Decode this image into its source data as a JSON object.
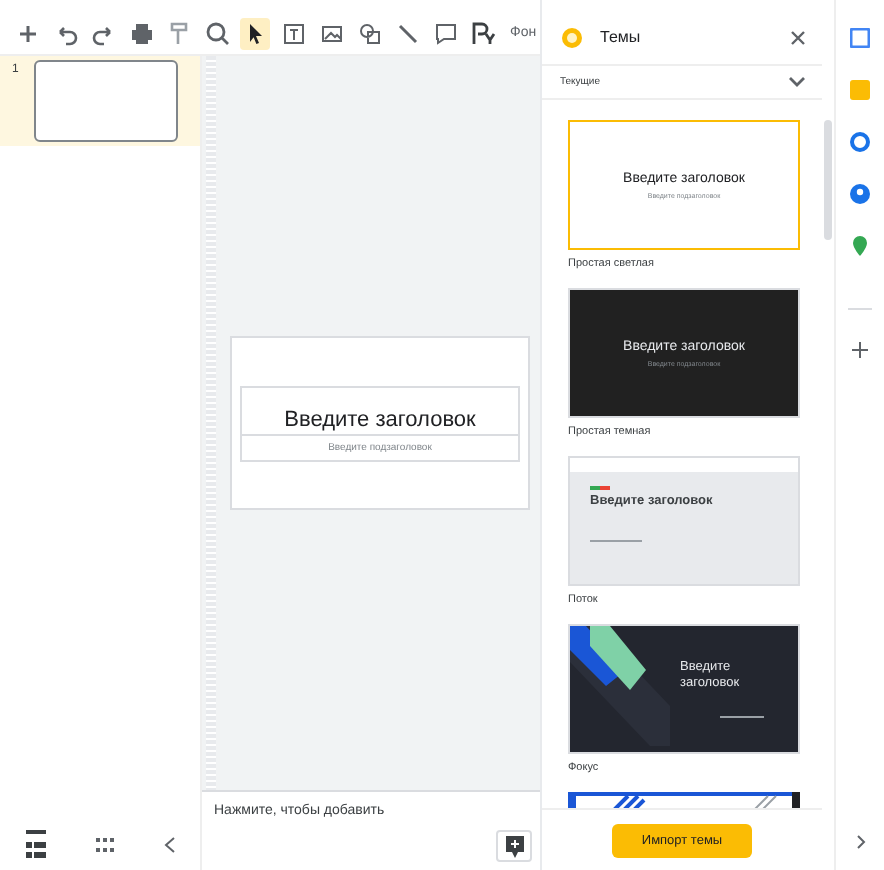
{
  "toolbar": {
    "tools": [
      {
        "kind": "plus",
        "selected": false
      },
      {
        "kind": "undo",
        "selected": false
      },
      {
        "kind": "redo",
        "selected": false
      },
      {
        "kind": "print",
        "selected": false
      },
      {
        "kind": "paint",
        "selected": false
      },
      {
        "kind": "zoom",
        "selected": false
      },
      {
        "kind": "cursor",
        "selected": true
      },
      {
        "kind": "textbox",
        "selected": false
      },
      {
        "kind": "image",
        "selected": false
      },
      {
        "kind": "shape",
        "selected": false
      },
      {
        "kind": "line",
        "selected": false
      },
      {
        "kind": "comment",
        "selected": false
      },
      {
        "kind": "style",
        "selected": false
      }
    ],
    "background_button": "Фон"
  },
  "filmstrip": {
    "slides": [
      {
        "number": "1",
        "selected": true
      }
    ]
  },
  "slide": {
    "title": "Введите заголовок",
    "subtitle": "Введите подзаголовок"
  },
  "notes": {
    "placeholder": "Нажмите, чтобы добавить"
  },
  "themes_panel": {
    "title": "Темы",
    "filter": "Текущие",
    "themes": [
      {
        "kind": "light",
        "name": "Простая светлая",
        "title": "Введите заголовок",
        "subtitle": "Введите подзаголовок",
        "selected": true
      },
      {
        "kind": "dark",
        "name": "Простая темная",
        "title": "Введите заголовок",
        "subtitle": "Введите подзаголовок",
        "selected": false
      },
      {
        "kind": "flow",
        "name": "Поток",
        "title": "Введите заголовок",
        "selected": false
      },
      {
        "kind": "focus",
        "name": "Фокус",
        "title": "Введите заголовок",
        "selected": false
      },
      {
        "kind": "partial",
        "selected": false
      }
    ],
    "import_button": "Импорт темы"
  }
}
